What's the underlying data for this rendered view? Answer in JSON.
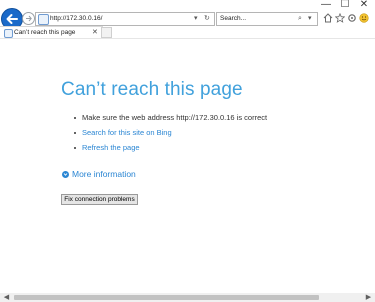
{
  "window": {
    "minimize_glyph": "—",
    "maximize_glyph": "☐",
    "close_glyph": "✕"
  },
  "nav": {
    "back_icon": "arrow-left-icon",
    "forward_icon": "arrow-right-icon"
  },
  "address_bar": {
    "url": "http://172.30.0.16/",
    "dropdown_glyph": "▾",
    "refresh_glyph": "↻"
  },
  "search_bar": {
    "placeholder": "Search...",
    "search_glyph": "⌕",
    "dropdown_glyph": "▾"
  },
  "toolbar_icons": [
    "home-icon",
    "star-icon",
    "gear-icon",
    "smiley-icon"
  ],
  "tabs": [
    {
      "title": "Can’t reach this page",
      "close_glyph": "✕"
    }
  ],
  "page": {
    "heading": "Can’t reach this page",
    "items": [
      {
        "text": "Make sure the web address http://172.30.0.16 is correct",
        "is_link": false
      },
      {
        "text": "Search for this site on Bing",
        "is_link": true
      },
      {
        "text": "Refresh the page",
        "is_link": true
      }
    ],
    "more_info_label": "More information",
    "fix_button_label": "Fix connection problems"
  },
  "colors": {
    "heading": "#41a1dc",
    "link": "#2b86d3",
    "back_button": "#1b6ac9"
  },
  "scrollbar": {
    "left_glyph": "◀",
    "right_glyph": "▶"
  }
}
